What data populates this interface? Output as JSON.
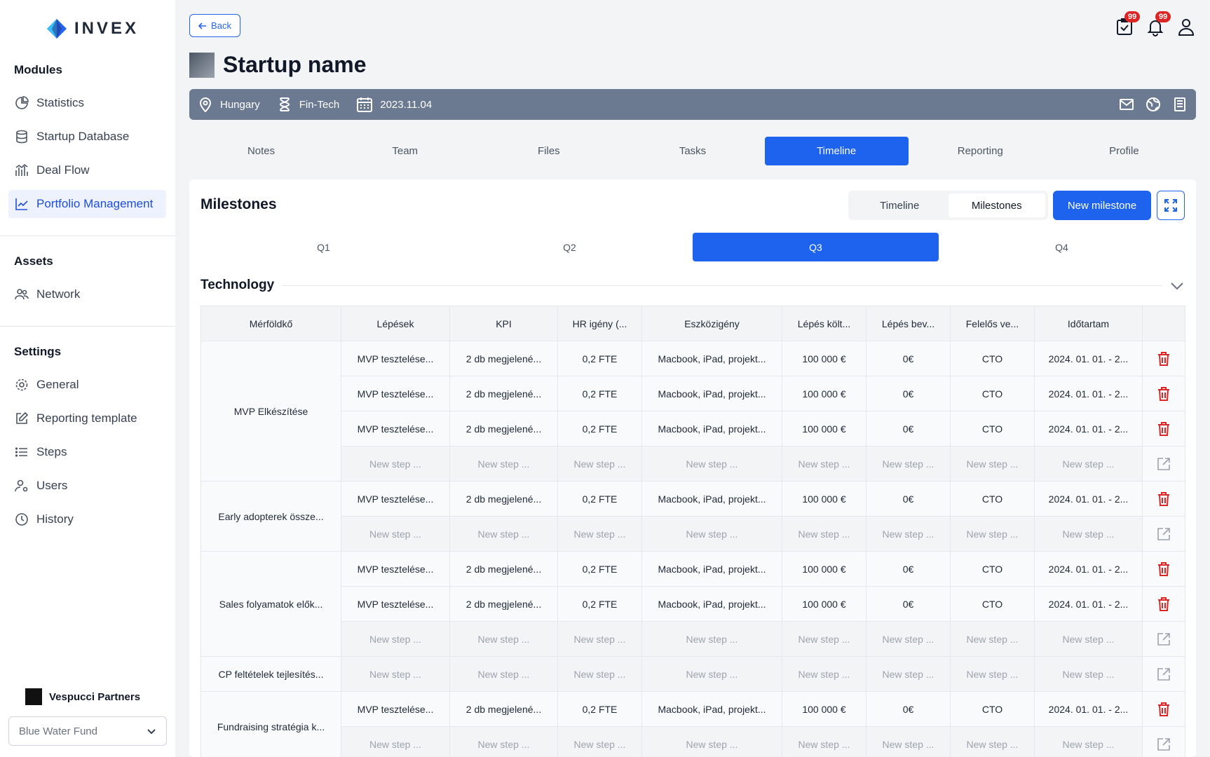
{
  "app": {
    "brand": "INVEX"
  },
  "sidebar": {
    "modules_title": "Modules",
    "modules": [
      {
        "label": "Statistics",
        "icon": "statistics-icon"
      },
      {
        "label": "Startup Database",
        "icon": "database-icon"
      },
      {
        "label": "Deal Flow",
        "icon": "deal-flow-icon"
      },
      {
        "label": "Portfolio Management",
        "icon": "portfolio-icon",
        "active": true
      }
    ],
    "assets_title": "Assets",
    "assets": [
      {
        "label": "Network",
        "icon": "network-icon"
      }
    ],
    "settings_title": "Settings",
    "settings": [
      {
        "label": "General",
        "icon": "gear-icon"
      },
      {
        "label": "Reporting template",
        "icon": "edit-icon"
      },
      {
        "label": "Steps",
        "icon": "list-icon"
      },
      {
        "label": "Users",
        "icon": "users-icon"
      },
      {
        "label": "History",
        "icon": "history-icon"
      }
    ],
    "org_name": "Vespucci Partners",
    "fund_selected": "Blue Water Fund"
  },
  "header": {
    "back_label": "Back",
    "badges": {
      "tasks": "99",
      "notifications": "99"
    },
    "title": "Startup name",
    "info": {
      "country": "Hungary",
      "industry": "Fin-Tech",
      "date": "2023.11.04"
    }
  },
  "tabs": [
    "Notes",
    "Team",
    "Files",
    "Tasks",
    "Timeline",
    "Reporting",
    "Profile"
  ],
  "active_tab": "Timeline",
  "milestones": {
    "title": "Milestones",
    "view_toggle": [
      "Timeline",
      "Milestones"
    ],
    "view_active": "Milestones",
    "new_label": "New milestone",
    "quarters": [
      "Q1",
      "Q2",
      "Q3",
      "Q4"
    ],
    "quarter_active": "Q3",
    "section_title": "Technology",
    "columns": [
      "Mérföldkő",
      "Lépések",
      "KPI",
      "HR igény (...",
      "Eszközigény",
      "Lépés költ...",
      "Lépés bev...",
      "Felelős ve...",
      "Időtartam"
    ],
    "step": [
      "MVP tesztelése...",
      "2 db megjelené...",
      "0,2 FTE",
      "Macbook, iPad, projekt...",
      "100 000 €",
      "0€",
      "CTO",
      "2024. 01. 01. - 2..."
    ],
    "new_step": "New step ...",
    "groups": [
      {
        "name": "MVP Elkészítése",
        "steps": 3
      },
      {
        "name": "Early adopterek össze...",
        "steps": 1
      },
      {
        "name": "Sales folyamatok elők...",
        "steps": 2
      },
      {
        "name": "CP feltételek tejlesítés...",
        "steps": 0
      },
      {
        "name": "Fundraising stratégia k...",
        "steps": 1
      }
    ]
  },
  "colors": {
    "accent": "#1d63ed",
    "danger": "#dc2626",
    "infobar": "#6b7a90"
  }
}
